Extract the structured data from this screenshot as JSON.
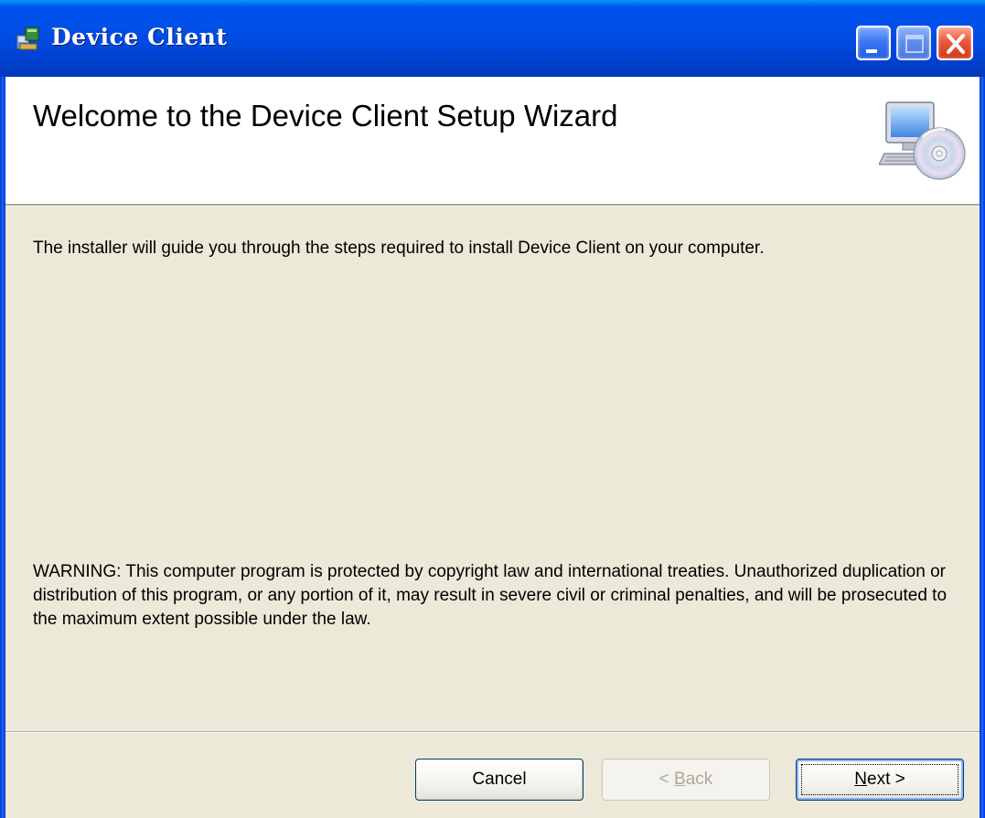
{
  "window": {
    "title": "Device Client"
  },
  "banner": {
    "title": "Welcome to the Device Client Setup Wizard"
  },
  "body": {
    "intro": "The installer will guide you through the steps required to install Device Client on your computer.",
    "warning": "WARNING: This computer program is protected by copyright law and international treaties. Unauthorized duplication or distribution of this program, or any portion of it, may result in severe civil or criminal penalties, and will be prosecuted to the maximum extent possible under the law."
  },
  "buttons": {
    "cancel": "Cancel",
    "back_prefix": "< ",
    "back_accel": "B",
    "back_rest": "ack",
    "next_accel": "N",
    "next_rest": "ext >"
  },
  "icons": {
    "app": "installer-icon",
    "banner": "computer-cd-icon",
    "minimize": "minimize-icon",
    "maximize": "maximize-icon",
    "close": "close-icon"
  },
  "colors": {
    "titlebar": "#0054e3",
    "client_bg": "#ece9d8",
    "close_button": "#e9593a"
  }
}
